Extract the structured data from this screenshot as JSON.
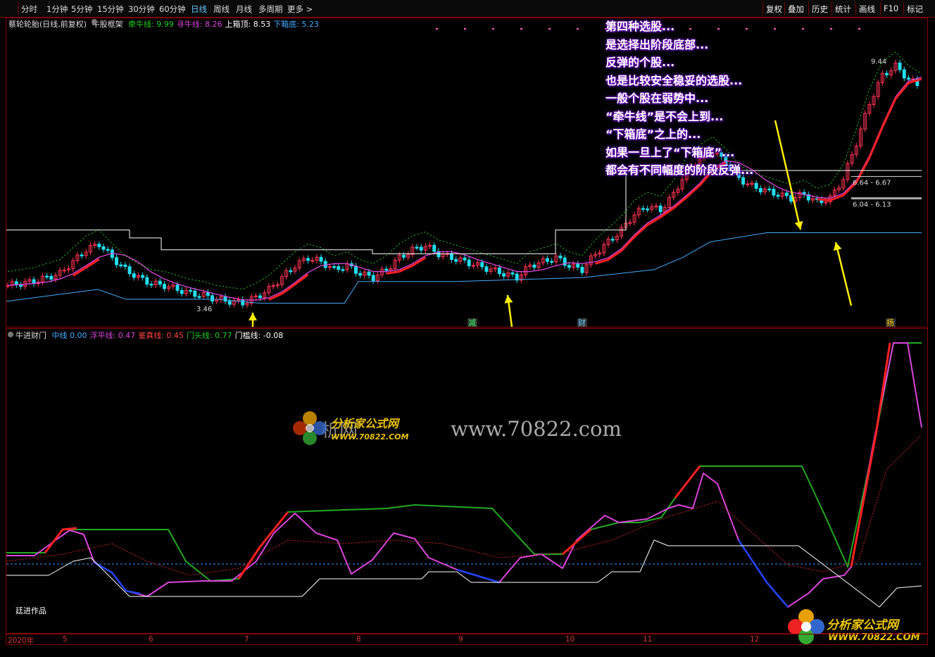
{
  "toolbar": {
    "periods": [
      {
        "label": "分时"
      },
      {
        "label": "1分钟"
      },
      {
        "label": "5分钟"
      },
      {
        "label": "15分钟"
      },
      {
        "label": "30分钟"
      },
      {
        "label": "60分钟"
      },
      {
        "label": "日线",
        "active": true
      },
      {
        "label": "周线"
      },
      {
        "label": "月线"
      },
      {
        "label": "多周期"
      },
      {
        "label": "更多 >"
      }
    ],
    "tools": [
      "复权",
      "叠加",
      "历史",
      "统计",
      "画线",
      "F10",
      "标记"
    ]
  },
  "main_chart": {
    "title": "蔡轮轮胎(日线,前复权)",
    "indicator_name": "牛股框架",
    "legend": [
      {
        "label": "牵牛线:",
        "value": "9.99",
        "color": "#22cc22"
      },
      {
        "label": "寻牛线:",
        "value": "8.26",
        "color": "#dd44dd"
      },
      {
        "label": "上箱顶:",
        "value": "8.53",
        "color": "#ffffff"
      },
      {
        "label": "下箱底:",
        "value": "5.23",
        "color": "#44aaff"
      }
    ],
    "price_labels": {
      "high": "9.44",
      "low": "3.46",
      "range_upper": "6.64 - 6.67",
      "range_lower": "6.04 - 6.13"
    },
    "markers": [
      "减",
      "财",
      "扬"
    ]
  },
  "annotation": {
    "lines": [
      "第四种选股...",
      "是选择出阶段底部...",
      "反弹的个股...",
      "也是比较安全稳妥的选股...",
      "一般个股在弱势中...",
      "“牵牛线”是不会上到...",
      "“下箱底”之上的...",
      "如果一旦上了“下箱底”...",
      "都会有不同幅度的阶段反弹..."
    ]
  },
  "sub_chart": {
    "indicator_name": "牛进财门",
    "legend": [
      {
        "label": "中线",
        "value": "0.00",
        "color": "#44aaff"
      },
      {
        "label": "浮平线:",
        "value": "0.47",
        "color": "#dd44dd"
      },
      {
        "label": "鉴真线:",
        "value": "0.45",
        "color": "#ff4444"
      },
      {
        "label": "门头线:",
        "value": "0.77",
        "color": "#22cc22"
      },
      {
        "label": "门槛线:",
        "value": "-0.08",
        "color": "#ffffff"
      }
    ]
  },
  "date_axis": [
    "2020年",
    "5",
    "6",
    "7",
    "8",
    "9",
    "10",
    "11",
    "12"
  ],
  "watermark": {
    "logo_text": "分析家公式网",
    "logo_url": "WWW.70822.COM",
    "site_cn": "析网",
    "url": "www.70822.com"
  },
  "author": "廷进作品",
  "colors": {
    "up_candle": "#ff3355",
    "down_candle": "#22ddee",
    "ma_red": "#ff2020",
    "ma_magenta": "#dd44dd",
    "box_top": "#ffffff",
    "box_bottom": "#44aaff",
    "arrow": "#ffee00",
    "annotation_glow": "#6a00c8"
  },
  "chart_data": {
    "type": "line",
    "close_series": [
      3.9,
      3.95,
      4.0,
      4.1,
      4.2,
      4.5,
      4.8,
      4.95,
      4.6,
      4.3,
      4.1,
      3.95,
      3.9,
      3.8,
      3.7,
      3.65,
      3.55,
      3.5,
      3.46,
      3.6,
      3.8,
      4.1,
      4.4,
      4.6,
      4.5,
      4.3,
      4.4,
      4.2,
      4.1,
      4.3,
      4.6,
      4.8,
      4.9,
      4.7,
      4.6,
      4.5,
      4.4,
      4.3,
      4.2,
      4.1,
      4.4,
      4.5,
      4.6,
      4.4,
      4.3,
      4.7,
      5.0,
      5.3,
      5.7,
      5.9,
      5.8,
      6.2,
      6.8,
      7.1,
      7.3,
      7.0,
      6.6,
      6.4,
      6.3,
      6.2,
      6.1,
      6.2,
      6.0,
      6.1,
      6.6,
      7.5,
      8.5,
      9.2,
      9.44,
      9.1,
      8.9
    ]
  }
}
